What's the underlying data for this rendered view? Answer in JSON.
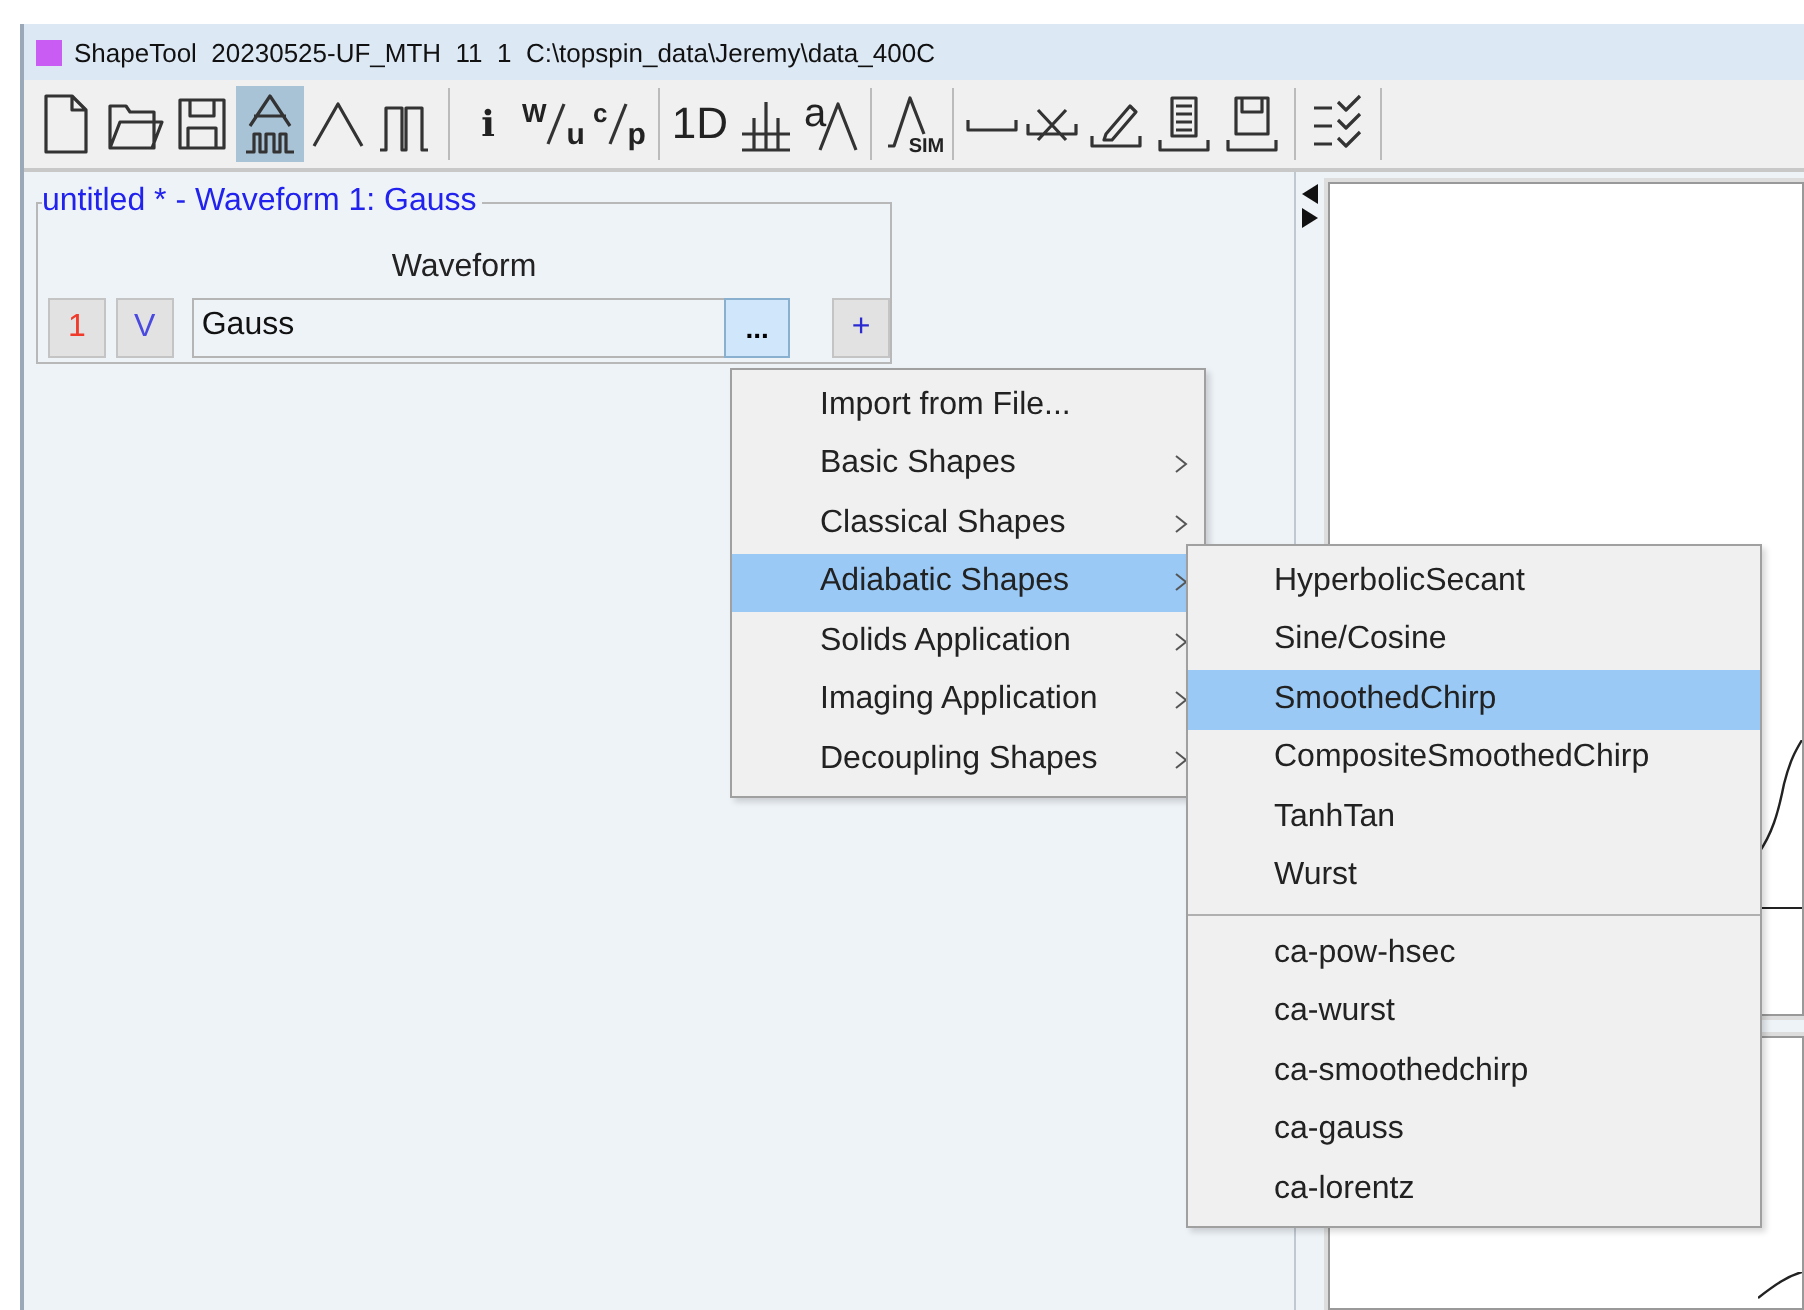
{
  "window": {
    "title": "ShapeTool  20230525-UF_MTH  11  1  C:\\topspin_data\\Jeremy\\data_400C"
  },
  "toolbar": [
    {
      "kind": "new"
    },
    {
      "kind": "open"
    },
    {
      "kind": "save"
    },
    {
      "kind": "shapes",
      "selected": true
    },
    {
      "kind": "peak",
      "selected": false
    },
    {
      "kind": "pulses",
      "selected": false
    },
    {
      "kind": "sep"
    },
    {
      "kind": "text",
      "label": "i"
    },
    {
      "kind": "fraction",
      "top": "W",
      "bottom": "u"
    },
    {
      "kind": "fraction",
      "top": "c",
      "bottom": "p"
    },
    {
      "kind": "sep"
    },
    {
      "kind": "text",
      "label": "1D"
    },
    {
      "kind": "comb"
    },
    {
      "kind": "apeak",
      "label": "a"
    },
    {
      "kind": "sep"
    },
    {
      "kind": "sim",
      "label": "SIM"
    },
    {
      "kind": "sep"
    },
    {
      "kind": "flat"
    },
    {
      "kind": "crossed"
    },
    {
      "kind": "pencil"
    },
    {
      "kind": "calc"
    },
    {
      "kind": "save2"
    },
    {
      "kind": "sep"
    },
    {
      "kind": "checklist"
    },
    {
      "kind": "sep"
    }
  ],
  "panel": {
    "group_title": "untitled * - Waveform 1: Gauss",
    "heading": "Waveform",
    "index_button": "1",
    "v_button": "V",
    "waveform": "Gauss",
    "browse_button": "...",
    "add_button": "+"
  },
  "menu": [
    {
      "label": "Import from File...",
      "submenu": false,
      "selected": false
    },
    {
      "label": "Basic Shapes",
      "submenu": true,
      "selected": false
    },
    {
      "label": "Classical Shapes",
      "submenu": true,
      "selected": false
    },
    {
      "label": "Adiabatic Shapes",
      "submenu": true,
      "selected": true
    },
    {
      "label": "Solids Application",
      "submenu": true,
      "selected": false
    },
    {
      "label": "Imaging Application",
      "submenu": true,
      "selected": false
    },
    {
      "label": "Decoupling Shapes",
      "submenu": true,
      "selected": false
    }
  ],
  "submenu": [
    [
      {
        "label": "HyperbolicSecant",
        "selected": false
      },
      {
        "label": "Sine/Cosine",
        "selected": false
      },
      {
        "label": "SmoothedChirp",
        "selected": true
      },
      {
        "label": "CompositeSmoothedChirp",
        "selected": false
      },
      {
        "label": "TanhTan",
        "selected": false
      },
      {
        "label": "Wurst",
        "selected": false
      }
    ],
    [
      {
        "label": "ca-pow-hsec",
        "selected": false
      },
      {
        "label": "ca-wurst",
        "selected": false
      },
      {
        "label": "ca-smoothedchirp",
        "selected": false
      },
      {
        "label": "ca-gauss",
        "selected": false
      },
      {
        "label": "ca-lorentz",
        "selected": false
      }
    ]
  ]
}
